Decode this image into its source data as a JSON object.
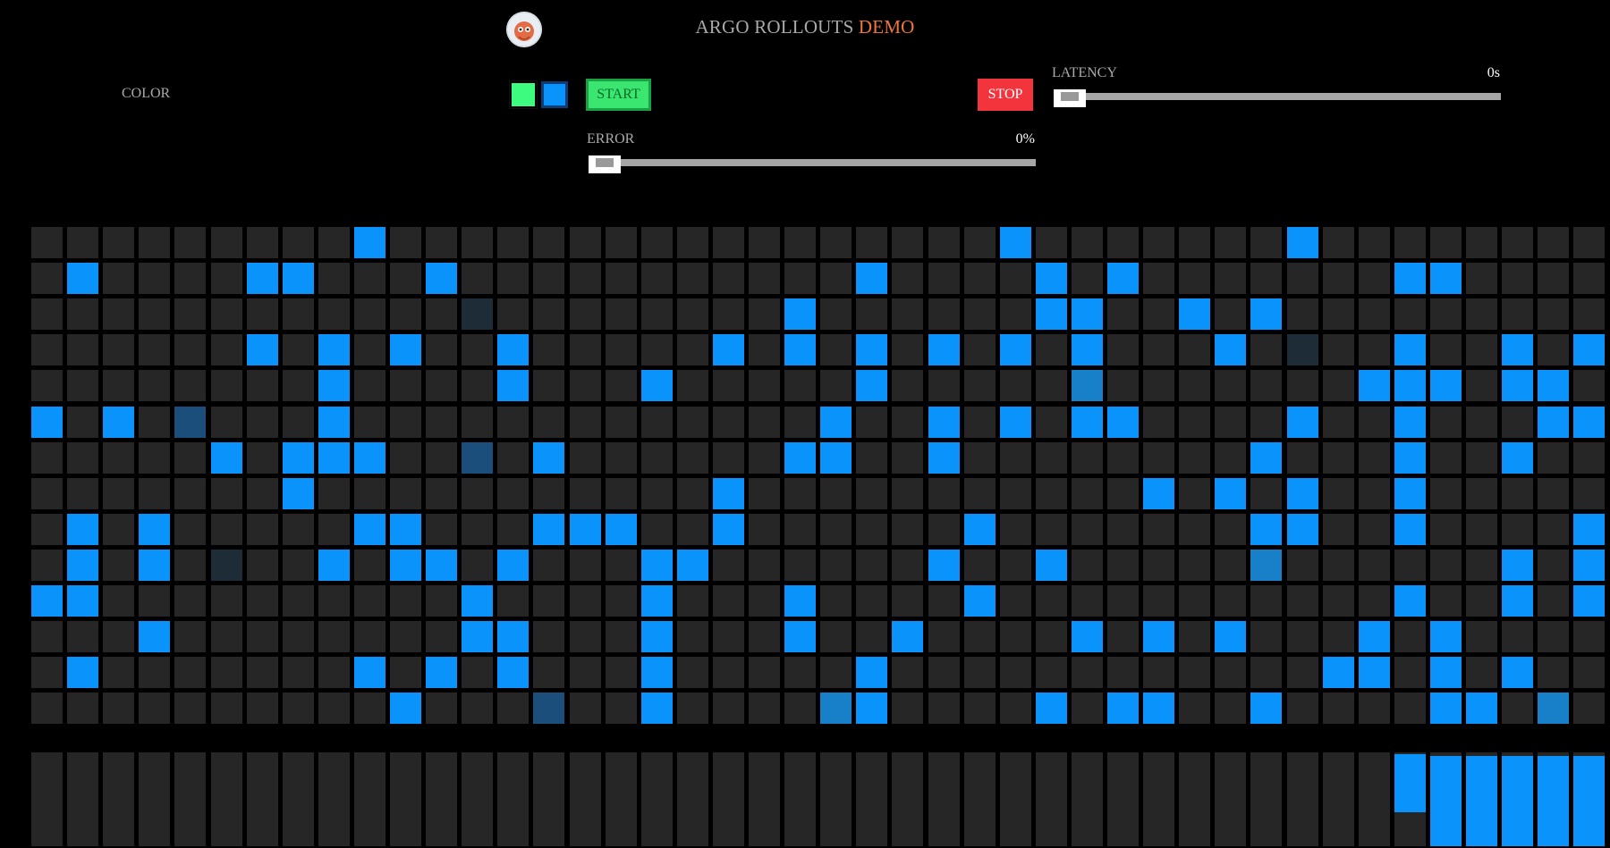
{
  "header": {
    "title_main": "ARGO ROLLOUTS",
    "title_accent": "DEMO",
    "logo_icon": "argo-octopus-icon"
  },
  "controls": {
    "color_label": "COLOR",
    "colors": [
      "#3dfb7f",
      "#0a93fa"
    ],
    "selected_color": "#0a93fa",
    "start_label": "START",
    "stop_label": "STOP",
    "latency_label": "LATENCY",
    "latency_value": "0s",
    "latency_fraction": 0,
    "error_label": "ERROR",
    "error_value": "0%",
    "error_fraction": 0
  },
  "palette": {
    "background": "#000000",
    "empty_cell": "#262626",
    "active": "#0a93fa",
    "accent_orange": "#f2763a",
    "start_green": "#3ae66f",
    "stop_red": "#f4343d"
  },
  "grid": {
    "columns": 44,
    "rows": 14,
    "legend": {
      "0": "empty",
      "1": "blue",
      "2": "blue-medium",
      "3": "blue-dim",
      "4": "blue-faint"
    },
    "cells": [
      "00000000010000000000000000010000000100000000",
      "01000011000100000000000100001010000000110000",
      "00000000000040000000010000001100101000000000",
      "00000010101001000001010101010100010400100101",
      "00000000100001000100000100000200000001110110",
      "10103000100000000000001001010110000100100011",
      "00000101110030100000011001000000001000100100",
      "00000001000000000001000000000001010100100000",
      "01010000011000111001000000100000001100100001",
      "01010400101101000110000001001000002000000101",
      "11000000000010000100010000100000000000100101",
      "00010000000011000100010010000101010001010000",
      "01000000010101000100000100000000000011010100",
      "00000000001000300100002100001011001000011020"
    ]
  },
  "bars": {
    "count": 44,
    "fill_levels": [
      0,
      0,
      0,
      0,
      0,
      0,
      0,
      0,
      0,
      0,
      0,
      0,
      0,
      0,
      0,
      0,
      0,
      0,
      0,
      0,
      0,
      0,
      0,
      0,
      0,
      0,
      0,
      0,
      0,
      0,
      0,
      0,
      0,
      0,
      0,
      0,
      0,
      0,
      0.64,
      1,
      1,
      1,
      1,
      1
    ]
  }
}
